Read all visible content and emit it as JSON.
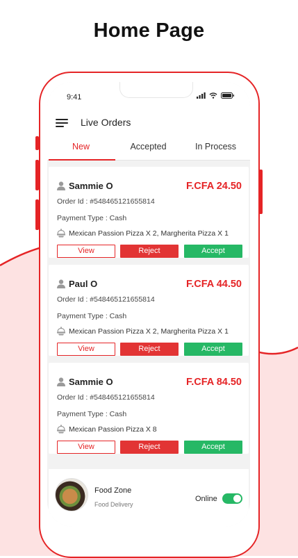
{
  "headline": "Home Page",
  "status_bar": {
    "time": "9:41"
  },
  "app_bar": {
    "title": "Live Orders"
  },
  "tabs": [
    {
      "label": "New",
      "active": true
    },
    {
      "label": "Accepted",
      "active": false
    },
    {
      "label": "In Process",
      "active": false
    }
  ],
  "orders": [
    {
      "customer": "Sammie O",
      "price": "F.CFA 24.50",
      "order_id": "Order Id : #548465121655814",
      "payment": "Payment Type : Cash",
      "items": "Mexican Passion Pizza X 2, Margherita Pizza X 1"
    },
    {
      "customer": "Paul O",
      "price": "F.CFA 44.50",
      "order_id": "Order Id : #548465121655814",
      "payment": "Payment Type : Cash",
      "items": "Mexican Passion Pizza X 2, Margherita Pizza X 1"
    },
    {
      "customer": "Sammie O",
      "price": "F.CFA 84.50",
      "order_id": "Order Id : #548465121655814",
      "payment": "Payment Type : Cash",
      "items": "Mexican Passion Pizza X 8"
    }
  ],
  "buttons": {
    "view": "View",
    "reject": "Reject",
    "accept": "Accept"
  },
  "footer": {
    "shop_name": "Food Zone",
    "shop_type": "Food Delivery",
    "status_label": "Online",
    "online": true
  },
  "colors": {
    "accent": "#e52426",
    "accept": "#26b865",
    "reject": "#e23434",
    "wave": "#fde2e2"
  }
}
